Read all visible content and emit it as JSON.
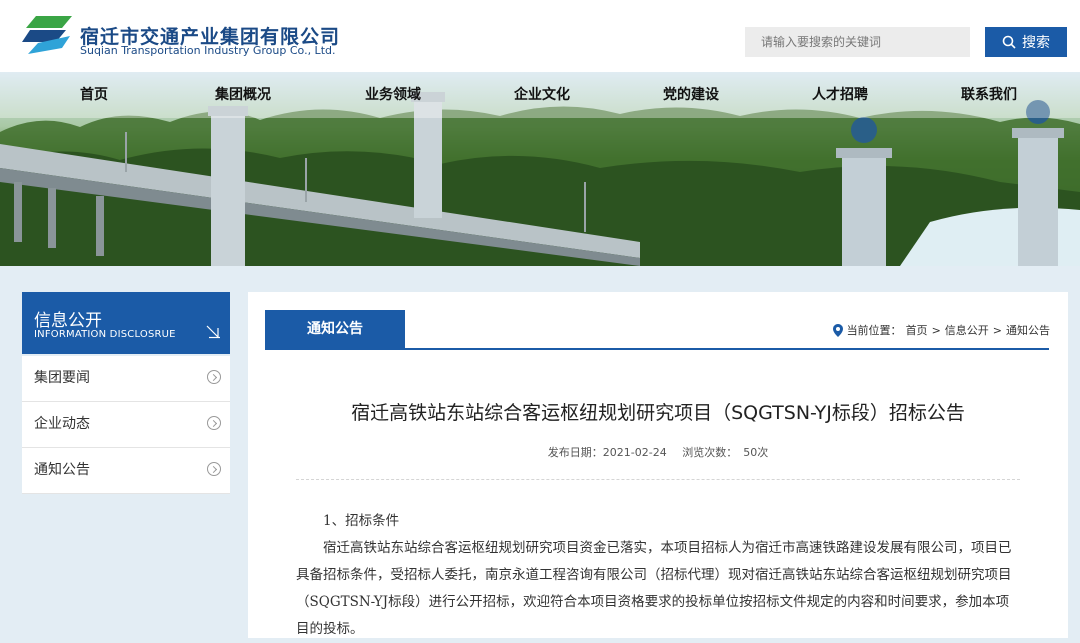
{
  "brand": {
    "name_cn": "宿迁市交通产业集团有限公司",
    "name_en": "Suqian Transportation Industry Group Co., Ltd."
  },
  "search": {
    "placeholder": "请输入要搜索的关键词",
    "button_label": "搜索"
  },
  "nav": {
    "items": [
      "首页",
      "集团概况",
      "业务领域",
      "企业文化",
      "党的建设",
      "人才招聘",
      "联系我们"
    ]
  },
  "sidebar": {
    "title": "信息公开",
    "subtitle": "INFORMATION DISCLOSRUE",
    "items": [
      "集团要闻",
      "企业动态",
      "通知公告"
    ]
  },
  "main": {
    "tab_label": "通知公告",
    "breadcrumb": {
      "prefix": "当前位置：",
      "items": [
        "首页",
        "信息公开",
        "通知公告"
      ],
      "separator": ">"
    },
    "article": {
      "title": "宿迁高铁站东站综合客运枢纽规划研究项目（SQGTSN-YJ标段）招标公告",
      "date_label": "发布日期：",
      "date": "2021-02-24",
      "views_label": "浏览次数：",
      "views": "50次",
      "section_heading": "1、招标条件",
      "paragraph": "宿迁高铁站东站综合客运枢纽规划研究项目资金已落实，本项目招标人为宿迁市高速铁路建设发展有限公司，项目已具备招标条件，受招标人委托，南京永道工程咨询有限公司（招标代理）现对宿迁高铁站东站综合客运枢纽规划研究项目（SQGTSN-YJ标段）进行公开招标，欢迎符合本项目资格要求的投标单位按招标文件规定的内容和时间要求，参加本项目的投标。"
    }
  },
  "colors": {
    "primary": "#1b5ba7",
    "page_bg": "#e3edf4",
    "logo_green": "#3aa545",
    "logo_blue": "#1b4a86"
  },
  "icons": {
    "logo": "logo-mark-icon",
    "search": "magnifier-icon",
    "sidebar_arrow": "arrow-down-right-icon",
    "list_chevron": "circle-chevron-right-icon",
    "location": "location-pin-icon"
  }
}
